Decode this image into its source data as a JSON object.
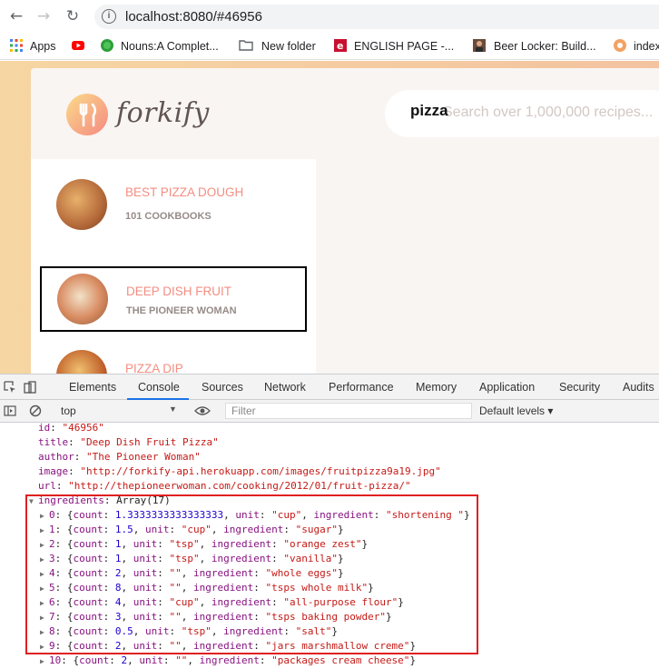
{
  "browser": {
    "url": "localhost:8080/#46956",
    "bookmarks": [
      {
        "label": "Apps",
        "icon": "apps-grid-icon"
      },
      {
        "label": "",
        "icon": "youtube-icon"
      },
      {
        "label": "Nouns:A Complet...",
        "icon": "green-circle-icon"
      },
      {
        "label": "New folder",
        "icon": "folder-icon"
      },
      {
        "label": "ENGLISH PAGE -...",
        "icon": "english-page-icon"
      },
      {
        "label": "Beer Locker: Build...",
        "icon": "avatar-icon"
      },
      {
        "label": "index",
        "icon": "site-icon"
      }
    ]
  },
  "app": {
    "logo": "forkify",
    "search_value": "pizza",
    "search_placeholder": "Search over 1,000,000 recipes...",
    "results": [
      {
        "title": "Best Pizza Dough",
        "publisher": "101 Cookbooks",
        "active": false
      },
      {
        "title": "Deep Dish Fruit",
        "publisher": "The Pioneer Woman",
        "active": true
      },
      {
        "title": "Pizza Dip",
        "publisher": "",
        "active": false
      }
    ]
  },
  "devtools": {
    "tabs": [
      "Elements",
      "Console",
      "Sources",
      "Network",
      "Performance",
      "Memory",
      "Application",
      "Security",
      "Audits"
    ],
    "selected_tab": "Console",
    "context": "top",
    "filter_placeholder": "Filter",
    "levels": "Default levels",
    "console": {
      "props": [
        {
          "key": "id",
          "value": "\"46956\""
        },
        {
          "key": "title",
          "value": "\"Deep Dish Fruit Pizza\""
        },
        {
          "key": "author",
          "value": "\"The Pioneer Woman\""
        },
        {
          "key": "image",
          "value": "\"http://forkify-api.herokuapp.com/images/fruitpizza9a19.jpg\""
        },
        {
          "key": "url",
          "value": "\"http://thepioneerwoman.com/cooking/2012/01/fruit-pizza/\""
        }
      ],
      "ingredients_label": "ingredients",
      "ingredients_summary": "Array(17)",
      "ingredients": [
        {
          "index": "0",
          "count": "1.3333333333333333",
          "unit": "\"cup\"",
          "ingredient": "\"shortening \""
        },
        {
          "index": "1",
          "count": "1.5",
          "unit": "\"cup\"",
          "ingredient": "\"sugar\""
        },
        {
          "index": "2",
          "count": "1",
          "unit": "\"tsp\"",
          "ingredient": "\"orange zest\""
        },
        {
          "index": "3",
          "count": "1",
          "unit": "\"tsp\"",
          "ingredient": "\"vanilla\""
        },
        {
          "index": "4",
          "count": "2",
          "unit": "\"\"",
          "ingredient": "\"whole eggs\""
        },
        {
          "index": "5",
          "count": "8",
          "unit": "\"\"",
          "ingredient": "\"tsps whole milk\""
        },
        {
          "index": "6",
          "count": "4",
          "unit": "\"cup\"",
          "ingredient": "\"all-purpose flour\""
        },
        {
          "index": "7",
          "count": "3",
          "unit": "\"\"",
          "ingredient": "\"tsps baking powder\""
        },
        {
          "index": "8",
          "count": "0.5",
          "unit": "\"tsp\"",
          "ingredient": "\"salt\""
        },
        {
          "index": "9",
          "count": "2",
          "unit": "\"\"",
          "ingredient": "\"jars marshmallow creme\""
        },
        {
          "index": "10",
          "count": "2",
          "unit": "\"\"",
          "ingredient": "\"packages cream cheese\""
        }
      ]
    }
  },
  "colors": {
    "accent": "#f38e82",
    "highlight_border": "#e02020",
    "devtools_tab_underline": "#1a73e8"
  }
}
